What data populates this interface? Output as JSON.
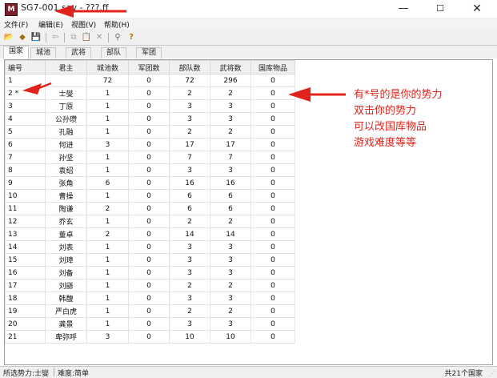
{
  "window": {
    "title": "SG7-001.sav - ???.ff",
    "icon_letter": "M",
    "controls": {
      "minimize": "—",
      "maximize": "☐",
      "close": "✕"
    }
  },
  "menu": [
    "文件(F)",
    "编辑(E)",
    "视图(V)",
    "帮助(H)"
  ],
  "toolbar_icons": [
    "open-icon",
    "tag-icon",
    "save-icon",
    "back-icon",
    "copy-icon",
    "paste-icon",
    "delete-icon",
    "find-icon",
    "help-icon"
  ],
  "toolbar_glyphs": [
    "📂",
    "◆",
    "💾",
    "⇦",
    "⧉",
    "📋",
    "✕",
    "⚲",
    "?"
  ],
  "tabs": [
    {
      "label": "国家",
      "active": true
    },
    {
      "label": "城池",
      "active": false
    },
    {
      "label": "武将",
      "active": false
    },
    {
      "label": "部队",
      "active": false
    },
    {
      "label": "军团",
      "active": false
    }
  ],
  "table": {
    "columns": [
      "编号",
      "君主",
      "城池数",
      "军团数",
      "部队数",
      "武将数",
      "国库物品"
    ],
    "rows": [
      [
        "1",
        "",
        "72",
        "0",
        "72",
        "296",
        "0"
      ],
      [
        "2 *",
        "士燮",
        "1",
        "0",
        "2",
        "2",
        "0"
      ],
      [
        "3",
        "丁原",
        "1",
        "0",
        "3",
        "3",
        "0"
      ],
      [
        "4",
        "公孙瓒",
        "1",
        "0",
        "3",
        "3",
        "0"
      ],
      [
        "5",
        "孔融",
        "1",
        "0",
        "2",
        "2",
        "0"
      ],
      [
        "6",
        "何进",
        "3",
        "0",
        "17",
        "17",
        "0"
      ],
      [
        "7",
        "孙坚",
        "1",
        "0",
        "7",
        "7",
        "0"
      ],
      [
        "8",
        "袁绍",
        "1",
        "0",
        "3",
        "3",
        "0"
      ],
      [
        "9",
        "张角",
        "6",
        "0",
        "16",
        "16",
        "0"
      ],
      [
        "10",
        "曹操",
        "1",
        "0",
        "6",
        "6",
        "0"
      ],
      [
        "11",
        "陶谦",
        "2",
        "0",
        "6",
        "6",
        "0"
      ],
      [
        "12",
        "乔玄",
        "1",
        "0",
        "2",
        "2",
        "0"
      ],
      [
        "13",
        "董卓",
        "2",
        "0",
        "14",
        "14",
        "0"
      ],
      [
        "14",
        "刘表",
        "1",
        "0",
        "3",
        "3",
        "0"
      ],
      [
        "15",
        "刘璋",
        "1",
        "0",
        "3",
        "3",
        "0"
      ],
      [
        "16",
        "刘备",
        "1",
        "0",
        "3",
        "3",
        "0"
      ],
      [
        "17",
        "刘繇",
        "1",
        "0",
        "2",
        "2",
        "0"
      ],
      [
        "18",
        "韩馥",
        "1",
        "0",
        "3",
        "3",
        "0"
      ],
      [
        "19",
        "严白虎",
        "1",
        "0",
        "2",
        "2",
        "0"
      ],
      [
        "20",
        "龚景",
        "1",
        "0",
        "3",
        "3",
        "0"
      ],
      [
        "21",
        "卑弥呼",
        "3",
        "0",
        "10",
        "10",
        "0"
      ]
    ]
  },
  "status": {
    "selected": "所选势力:士燮",
    "difficulty": "难度:简单",
    "count": "共21个国家"
  },
  "annotation": {
    "lines": [
      "有*号的是你的势力",
      "双击你的势力",
      "可以改国库物品",
      "游戏难度等等"
    ],
    "color": "#e0241b"
  }
}
